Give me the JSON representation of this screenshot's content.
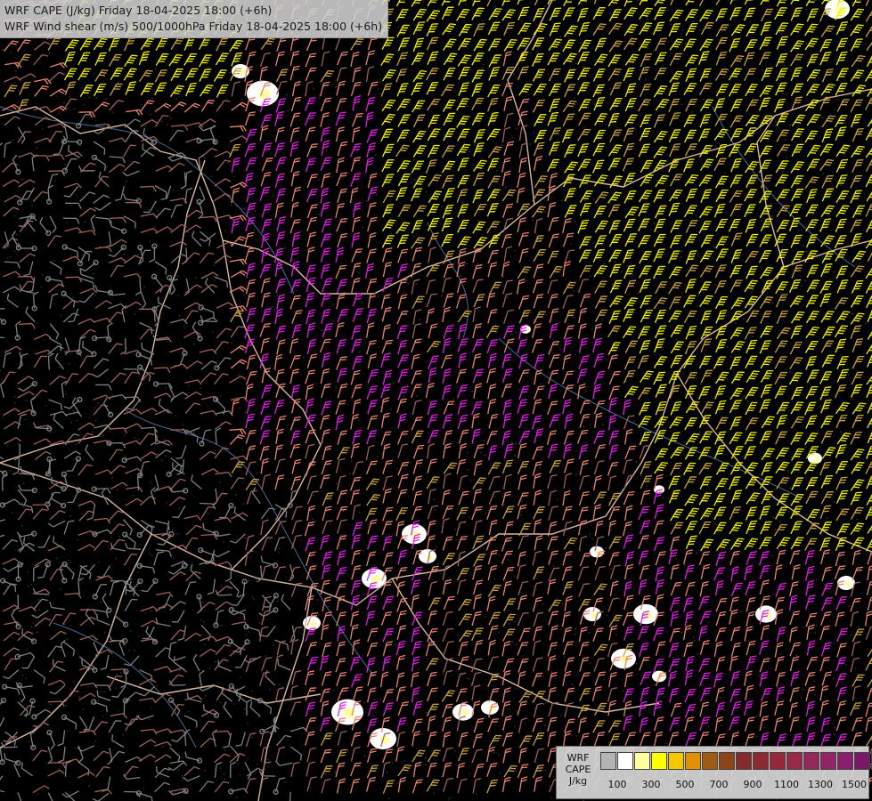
{
  "title": {
    "line1": "WRF CAPE (J/kg) Friday 18-04-2025 18:00 (+6h)",
    "line2": "WRF Wind shear (m/s) 500/1000hPa Friday 18-04-2025 18:00 (+6h)"
  },
  "legend": {
    "label_line1": "WRF",
    "label_line2": "CAPE",
    "label_line3": "J/kg",
    "colors": [
      "#b4b4b4",
      "#ffffff",
      "#ffff9e",
      "#ffff00",
      "#f5c800",
      "#e09000",
      "#a05a14",
      "#8c4418",
      "#822c2c",
      "#8c2a34",
      "#96283c",
      "#962a4a",
      "#942858",
      "#902464",
      "#8a1e6c",
      "#7a1868",
      "#701466",
      "#640f5e"
    ],
    "ticks": [
      "100",
      "300",
      "500",
      "700",
      "900",
      "1100",
      "1300",
      "1500"
    ]
  },
  "map": {
    "barb_colors": {
      "calm": "#7f7f7f",
      "weak": "#a0605a",
      "moderate": "#e8836e",
      "strong": "#e020e0",
      "very_strong": "#f0f000",
      "mixed": "#c8a040"
    },
    "border_color": "#d8b8a0",
    "river_color": "#4a6a9a"
  }
}
